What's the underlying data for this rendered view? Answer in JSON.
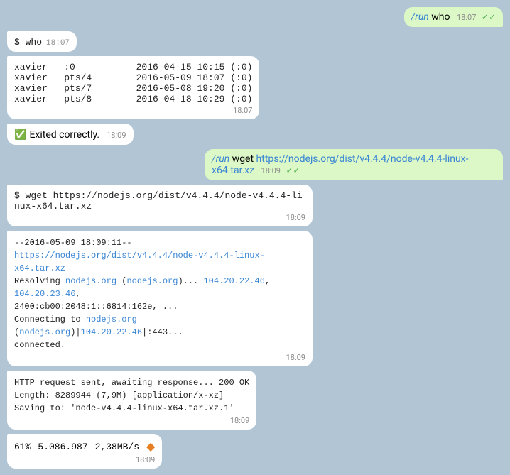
{
  "messages": [
    {
      "id": "msg-run-who",
      "type": "out",
      "run_prefix": "/run",
      "text": " who",
      "time": "18:07",
      "checkmarks": "✓✓"
    },
    {
      "id": "msg-who-cmd",
      "type": "in",
      "command": "$ who",
      "time": "18:07"
    },
    {
      "id": "msg-who-output",
      "type": "in",
      "lines": [
        "xavier   :0           2016-04-15 10:15 (:0)",
        "xavier   pts/4        2016-05-09 18:07 (:0)",
        "xavier   pts/7        2016-05-08 19:20 (:0)",
        "xavier   pts/8        2016-04-18 10:29 (:0)"
      ],
      "time": "18:07"
    },
    {
      "id": "msg-exited",
      "type": "in",
      "emoji": "✅",
      "text": " Exited correctly.",
      "time": "18:09"
    },
    {
      "id": "msg-run-wget",
      "type": "out",
      "run_prefix": "/run",
      "text": " wget ",
      "link": "https://nodejs.org/dist/v4.4.4/node-v4.4.4-linux-x64.tar.xz",
      "time": "18:09",
      "checkmarks": "✓✓"
    },
    {
      "id": "msg-wget-cmd",
      "type": "in",
      "command": "$ wget https://nodejs.org/dist/v4.4.4/node-v4.4.4-linux-x64.tar.xz",
      "time": "18:09"
    },
    {
      "id": "msg-wget-output1",
      "type": "in",
      "lines_mixed": true,
      "prefix": "--2016-05-09 18:09:11--  ",
      "link": "https://nodejs.org/dist/v4.4.4/node-v4.4.4-linux-x64.tar.xz",
      "extra": [
        "Resolving nodejs.org (nodejs.org)... 104.20.22.46, 104.20.23.46,",
        "2400:cb00:2048:1::6814:162e, ...",
        "Connecting to nodejs.org (nodejs.org)|104.20.22.46|:443...",
        "    connected."
      ],
      "time": "18:09"
    },
    {
      "id": "msg-wget-output2",
      "type": "in",
      "lines": [
        "HTTP request sent, awaiting response... 200 OK",
        "Length: 8289944 (7,9M) [application/x-xz]",
        "Saving to: 'node-v4.4.4-linux-x64.tar.xz.1'"
      ],
      "time": "18:09"
    },
    {
      "id": "msg-progress",
      "type": "in",
      "percent": "61%",
      "bytes": "5.086.987",
      "speed": "2,38MB/s",
      "diamond": "◆",
      "time": "18:09"
    }
  ],
  "labels": {
    "run": "/run",
    "checkmarks": "✓✓",
    "exited_emoji": "✅",
    "exited_text": "Exited correctly.",
    "diamond": "◆"
  }
}
